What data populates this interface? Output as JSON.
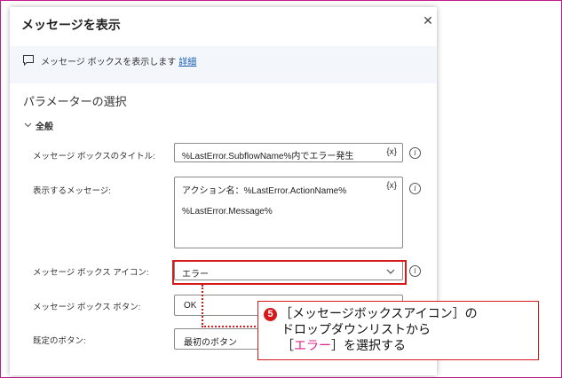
{
  "dialog": {
    "title": "メッセージを表示",
    "close_glyph": "✕",
    "description": "メッセージ ボックスを表示します",
    "details_link": "詳細",
    "section_title": "パラメーターの選択",
    "group_label": "全般"
  },
  "fields": {
    "title": {
      "label": "メッセージ ボックスのタイトル:",
      "value": "%LastError.SubflowName%内でエラー発生",
      "var_button": "{x}"
    },
    "message": {
      "label": "表示するメッセージ:",
      "value_line1": "アクション名：%LastError.ActionName%",
      "value_line2": "%LastError.Message%",
      "var_button": "{x}"
    },
    "icon": {
      "label": "メッセージ ボックス アイコン:",
      "value": "エラー"
    },
    "buttons": {
      "label": "メッセージ ボックス ボタン:",
      "value": "OK"
    },
    "default_button": {
      "label": "既定のボタン:",
      "value": "最初のボタン"
    }
  },
  "info_glyph": "i",
  "callout": {
    "number": "5",
    "line1": "［メッセージボックスアイコン］の",
    "line2": "ドロップダウンリストから",
    "line3_open": "［",
    "line3_accent": "エラー",
    "line3_close": "］を選択する"
  },
  "colors": {
    "frame": "#c21c8a",
    "highlight": "#d61a1a",
    "accent": "#e0208a",
    "link": "#1a5fb4"
  }
}
